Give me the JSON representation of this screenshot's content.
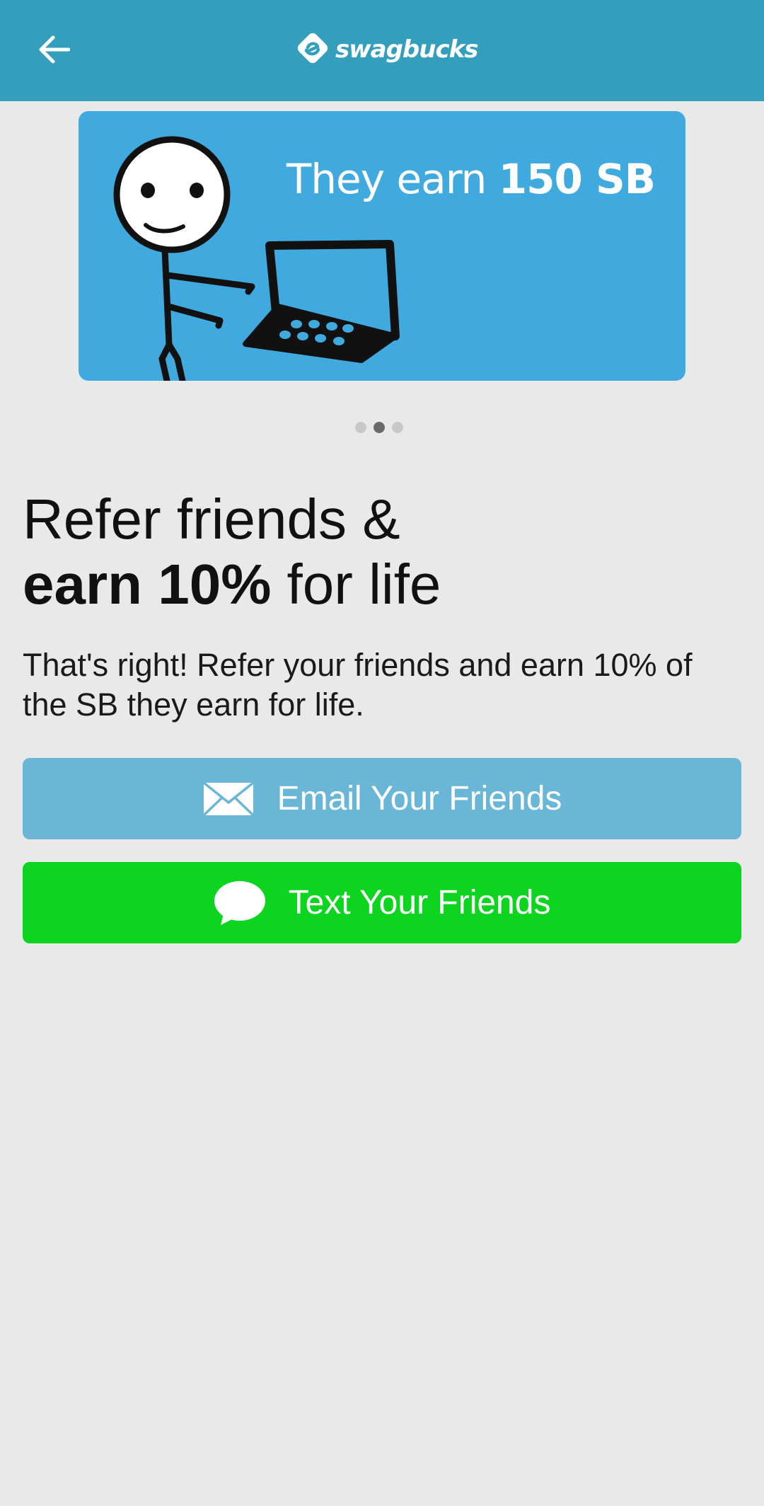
{
  "app_bar": {
    "brand": "swagbucks",
    "back_icon": "arrow-left-icon",
    "color": "#349fbd"
  },
  "banner": {
    "text_prefix": "They earn ",
    "text_bold": "150 SB",
    "color": "#40aadf",
    "carousel": {
      "count": 3,
      "active_index": 1
    }
  },
  "headline": {
    "line1": "Refer friends &",
    "line2_bold": "earn 10%",
    "line2_rest": " for life"
  },
  "subtext": "That's right! Refer your friends and earn 10% of the SB they earn for life.",
  "buttons": {
    "email": {
      "label": "Email Your Friends",
      "icon": "envelope-icon",
      "color": "#69b6d7"
    },
    "text": {
      "label": "Text Your Friends",
      "icon": "chat-bubble-icon",
      "color": "#0dd41f"
    }
  }
}
